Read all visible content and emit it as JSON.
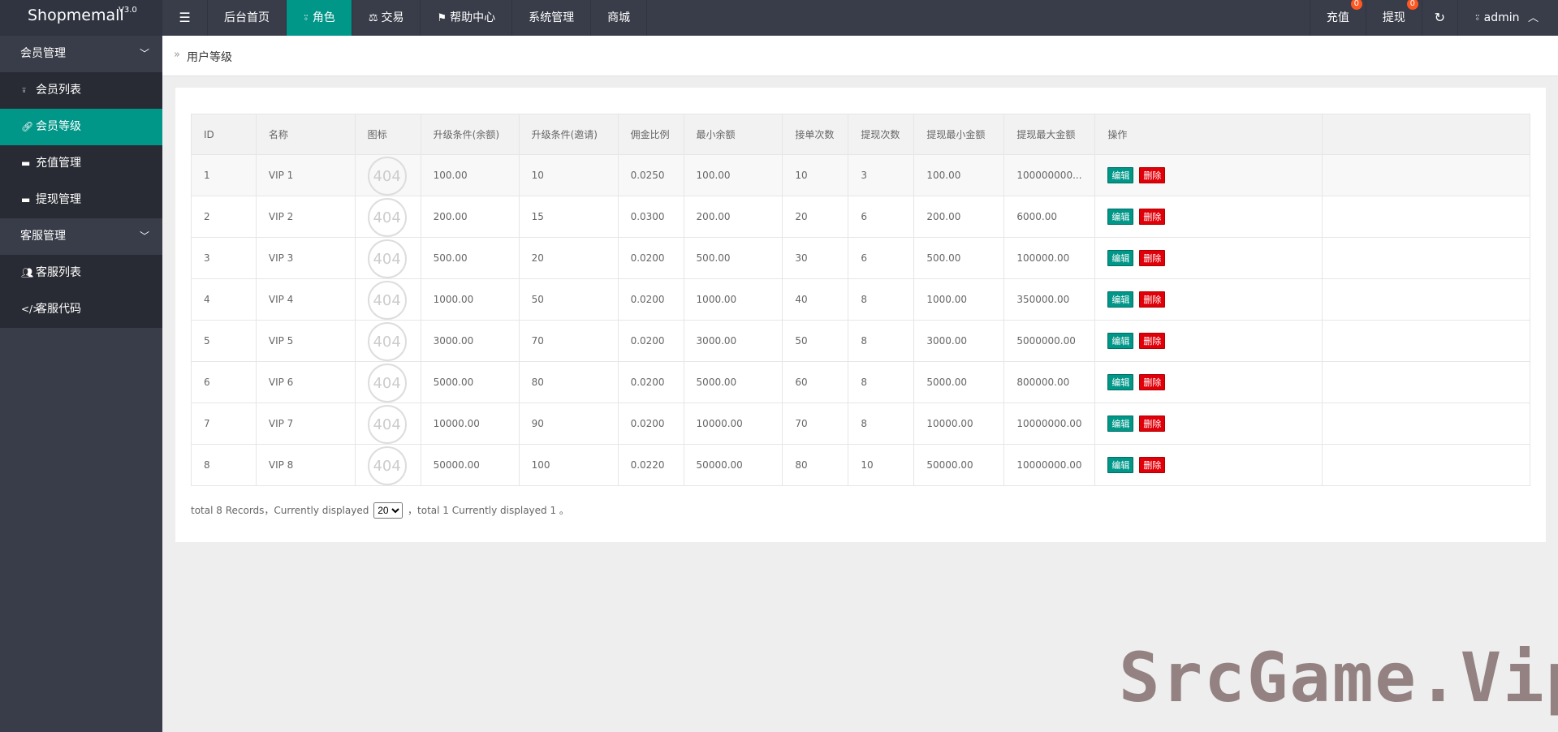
{
  "app": {
    "name": "Shopmemall",
    "version": "V3.0"
  },
  "nav": {
    "toggle_icon": "menu-icon",
    "items": [
      {
        "label": "后台首页",
        "icon": ""
      },
      {
        "label": "角色",
        "icon": "user-icon",
        "active": true
      },
      {
        "label": "交易",
        "icon": "scale-icon"
      },
      {
        "label": "帮助中心",
        "icon": "flag-icon"
      },
      {
        "label": "系统管理",
        "icon": ""
      },
      {
        "label": "商城",
        "icon": ""
      }
    ],
    "right": {
      "recharge_label": "充值",
      "recharge_badge": "0",
      "withdraw_label": "提现",
      "withdraw_badge": "0",
      "refresh_icon": "refresh-icon",
      "user_label": "admin"
    }
  },
  "sidebar": {
    "groups": [
      {
        "title": "会员管理",
        "items": [
          {
            "label": "会员列表",
            "icon": "user-icon"
          },
          {
            "label": "会员等级",
            "icon": "link-icon",
            "active": true
          },
          {
            "label": "充值管理",
            "icon": "card-icon"
          },
          {
            "label": "提现管理",
            "icon": "card-icon"
          }
        ]
      },
      {
        "title": "客服管理",
        "items": [
          {
            "label": "客服列表",
            "icon": "users-icon"
          },
          {
            "label": "客服代码",
            "icon": "code-icon"
          }
        ]
      }
    ]
  },
  "breadcrumb": {
    "current": "用户等级"
  },
  "table": {
    "headers": [
      "ID",
      "名称",
      "图标",
      "升级条件(余额)",
      "升级条件(邀请)",
      "佣金比例",
      "最小余额",
      "接单次数",
      "提现次数",
      "提现最小金额",
      "提现最大金额",
      "操作"
    ],
    "icon_placeholder": "404",
    "edit_label": "编辑",
    "delete_label": "删除",
    "rows": [
      [
        "1",
        "VIP 1",
        "",
        "100.00",
        "10",
        "0.0250",
        "100.00",
        "10",
        "3",
        "100.00",
        "100000000..."
      ],
      [
        "2",
        "VIP 2",
        "",
        "200.00",
        "15",
        "0.0300",
        "200.00",
        "20",
        "6",
        "200.00",
        "6000.00"
      ],
      [
        "3",
        "VIP 3",
        "",
        "500.00",
        "20",
        "0.0200",
        "500.00",
        "30",
        "6",
        "500.00",
        "100000.00"
      ],
      [
        "4",
        "VIP 4",
        "",
        "1000.00",
        "50",
        "0.0200",
        "1000.00",
        "40",
        "8",
        "1000.00",
        "350000.00"
      ],
      [
        "5",
        "VIP 5",
        "",
        "3000.00",
        "70",
        "0.0200",
        "3000.00",
        "50",
        "8",
        "3000.00",
        "5000000.00"
      ],
      [
        "6",
        "VIP 6",
        "",
        "5000.00",
        "80",
        "0.0200",
        "5000.00",
        "60",
        "8",
        "5000.00",
        "800000.00"
      ],
      [
        "7",
        "VIP 7",
        "",
        "10000.00",
        "90",
        "0.0200",
        "10000.00",
        "70",
        "8",
        "10000.00",
        "10000000.00"
      ],
      [
        "8",
        "VIP 8",
        "",
        "50000.00",
        "100",
        "0.0220",
        "50000.00",
        "80",
        "10",
        "50000.00",
        "10000000.00"
      ]
    ]
  },
  "pager": {
    "prefix": "total 8 Records，Currently displayed",
    "page_size": "20",
    "page_size_options": [
      "20"
    ],
    "suffix": "，total 1 Currently displayed 1 。"
  },
  "watermark": "SrcGame.Vip"
}
